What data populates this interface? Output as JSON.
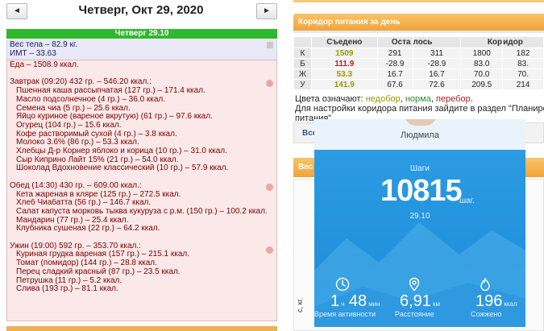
{
  "nav": {
    "prev": "◄",
    "next": "►",
    "title": "Четверг, Окт 29, 2020"
  },
  "day": {
    "label": "Четверг 29.10",
    "weight": "Вес тела – 82.9 кг.",
    "bmi": "ИМТ – 33.63",
    "food_total": "Еда – 1508.9 ккал."
  },
  "meals": [
    {
      "title": "Завтрак (09:20) 432 гр. – 546.20 ккал.:",
      "items": [
        "Пшенная каша рассыпчатая (127 гр.) – 171.4 ккал.",
        "Масло подсолнечное (4 гр.) – 36.0 ккал.",
        "Семена чиа (5 гр.) – 25.6 ккал.",
        "Яйцо куриное (вареное вкрутую) (61 гр.) – 97.6 ккал.",
        "Огурец (104 гр.) – 15.6 ккал.",
        "Кофе растворимый сухой (4 гр.) – 3.8 ккал.",
        "Молоко 3.6% (86 гр.) – 53.3 ккал.",
        "Хлебцы Д-р Корнер яблоко и корица (10 гр.) – 31.0 ккал.",
        "Сыр Киприно Лайт 15% (21 гр.) – 54.0 ккал.",
        "Шоколад Вдохновение классический (10 гр.) – 57.9 ккал."
      ]
    },
    {
      "title": "Обед (14:30) 430 гр. – 609.00 ккал.:",
      "items": [
        "Кета жареная в кляре (125 гр.) – 272.5 ккал.",
        "Хлеб Чиабатта (56 гр.) – 146.7 ккал.",
        "Салат капуста морковь тыква кукуруза с р.м. (150 гр.) – 100.2 ккал.",
        "Мандарин (77 гр.) – 25.4 ккал.",
        "Клубника сушеная (22 гр.) – 64.2 ккал."
      ]
    },
    {
      "title": "Ужин (19:00) 592 гр. – 353.70 ккал.:",
      "items": [
        "Куриная грудка вареная (157 гр.) – 215.1 ккал.",
        "Томат (помидор) (144 гр.) – 28.8 ккал.",
        "Перец сладкий красный (87 гр.) – 23.5 ккал.",
        "Петрушка (11 гр.) – 5.2 ккал.",
        "Слива (193 гр.) – 81.1 ккал."
      ]
    }
  ],
  "corridor": {
    "panel_title": "Коридор питания за день",
    "headers": [
      "",
      "Съедено",
      "Осталось",
      "",
      "Коридор",
      ""
    ],
    "rows": [
      {
        "label": "К",
        "eaten": "1509",
        "status": "low",
        "left_a": "291",
        "left_b": "311",
        "min": "1800",
        "max": "182"
      },
      {
        "label": "Б",
        "eaten": "111.9",
        "status": "over",
        "left_a": "-28.9",
        "left_b": "-28.9",
        "min": "83.0",
        "max": "83."
      },
      {
        "label": "Ж",
        "eaten": "53.3",
        "status": "low",
        "left_a": "16.7",
        "left_b": "16.7",
        "min": "70.0",
        "max": "70."
      },
      {
        "label": "У",
        "eaten": "141.9",
        "status": "low",
        "left_a": "67.6",
        "left_b": "72.6",
        "min": "209.5",
        "max": "214"
      }
    ],
    "legend_prefix": "Цвета означают:",
    "legend_low": "недобор",
    "legend_norm": "норма",
    "legend_over": "перебор",
    "plan_note_1": "Для настройки коридора питания зайдите в раздел \"Планирова",
    "plan_note_2": "питания\".",
    "colors": {
      "low": "#9a9a00",
      "norm": "#2e8b2e",
      "over": "#b22222",
      "panel": "#f0a43a"
    }
  },
  "right_panels": {
    "panel2": "Все",
    "panel3": "Вес",
    "axis": "с, кг."
  },
  "phone": {
    "user": "Людмила",
    "steps_label": "Шаги",
    "steps": "10815",
    "steps_unit": "шаг.",
    "date": "29.10",
    "activity_value": "1",
    "activity_h": "ч",
    "activity_min": "48",
    "activity_min_unit": "мин",
    "activity_label": "Время активности",
    "distance_value": "6,91",
    "distance_unit": "км",
    "distance_label": "Расстояние",
    "calories_value": "196",
    "calories_unit": "ккал",
    "calories_label": "Сожжено",
    "icons": [
      "clock-icon",
      "location-pin-icon",
      "flame-icon"
    ]
  }
}
